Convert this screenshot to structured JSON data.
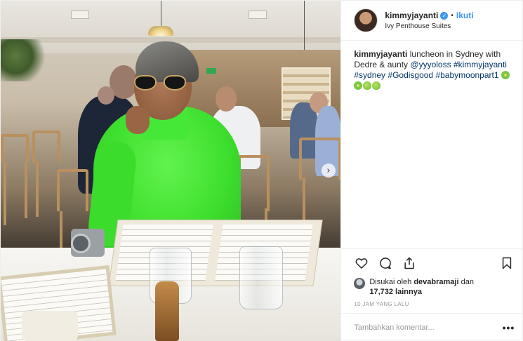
{
  "post": {
    "username": "kimmyjayanti",
    "verified": true,
    "separator": "•",
    "follow_label": "Ikuti",
    "location": "Ivy Penthouse Suites",
    "caption": {
      "username": "kimmyjayanti",
      "text1": " luncheon in Sydney with Dedre & aunty ",
      "mention": "@yyyoloss",
      "space": " ",
      "hashtag1": "#kimmyjayanti",
      "hashtag2": "#sydney",
      "hashtag3": "#Godisgood",
      "hashtag4": "#babymoonpart1",
      "emojis": [
        "kiwi",
        "kiwi",
        "green-apple",
        "green-apple"
      ]
    },
    "likes": {
      "prefix": "Disukai oleh ",
      "liker": "devabramaji",
      "conj": " dan",
      "count": "17,732 lainnya"
    },
    "timestamp": "10 JAM YANG LALU",
    "comment_placeholder": "Tambahkan komentar...",
    "more_options": "•••",
    "carousel_next": "›"
  },
  "icons": {
    "like": "heart-icon",
    "comment": "comment-bubble-icon",
    "share": "share-icon",
    "save": "bookmark-icon",
    "verified": "verified-badge-icon",
    "carousel": "chevron-right-icon"
  },
  "colors": {
    "link": "#003569",
    "follow": "#3897f0",
    "verified": "#3897f0",
    "border": "#efefef",
    "muted": "#999999"
  }
}
